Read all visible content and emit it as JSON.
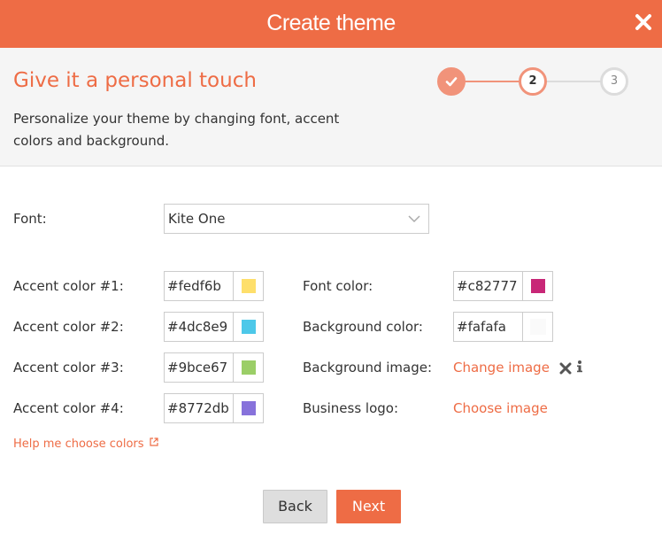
{
  "header": {
    "title": "Create theme"
  },
  "intro": {
    "title": "Give it a personal touch",
    "description": "Personalize your theme by changing font, accent colors and background."
  },
  "stepper": {
    "steps": [
      {
        "label": "",
        "state": "completed"
      },
      {
        "label": "2",
        "state": "current"
      },
      {
        "label": "3",
        "state": "upcoming"
      }
    ]
  },
  "font": {
    "label": "Font:",
    "value": "Kite One"
  },
  "accents": [
    {
      "label": "Accent color #1:",
      "hex": "#fedf6b"
    },
    {
      "label": "Accent color #2:",
      "hex": "#4dc8e9"
    },
    {
      "label": "Accent color #3:",
      "hex": "#9bce67"
    },
    {
      "label": "Accent color #4:",
      "hex": "#8772db"
    }
  ],
  "font_color": {
    "label": "Font color:",
    "hex": "#c82777"
  },
  "background_color": {
    "label": "Background color:",
    "hex": "#fafafa"
  },
  "background_image": {
    "label": "Background image:",
    "link": "Change image"
  },
  "business_logo": {
    "label": "Business logo:",
    "link": "Choose image"
  },
  "help_link": "Help me choose colors",
  "buttons": {
    "back": "Back",
    "next": "Next"
  },
  "colors": {
    "brand": "#ee6c45",
    "step_accent": "#f1937a",
    "step_inactive": "#dcdcdc"
  }
}
